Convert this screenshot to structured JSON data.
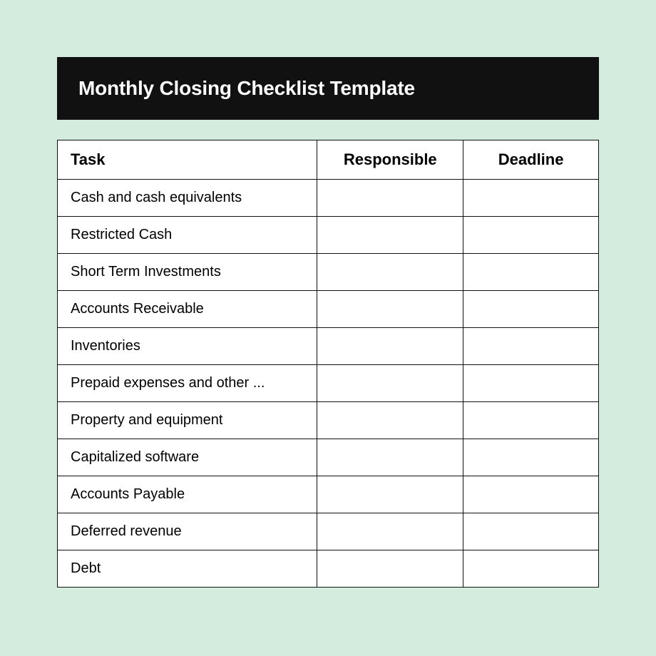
{
  "title": "Monthly Closing Checklist Template",
  "columns": {
    "task": "Task",
    "responsible": "Responsible",
    "deadline": "Deadline"
  },
  "rows": [
    {
      "task": "Cash and cash equivalents",
      "responsible": "",
      "deadline": ""
    },
    {
      "task": "Restricted Cash",
      "responsible": "",
      "deadline": ""
    },
    {
      "task": "Short Term Investments",
      "responsible": "",
      "deadline": ""
    },
    {
      "task": "Accounts Receivable",
      "responsible": "",
      "deadline": ""
    },
    {
      "task": "Inventories",
      "responsible": "",
      "deadline": ""
    },
    {
      "task": "Prepaid expenses and other ...",
      "responsible": "",
      "deadline": ""
    },
    {
      "task": "Property and equipment",
      "responsible": "",
      "deadline": ""
    },
    {
      "task": "Capitalized software",
      "responsible": "",
      "deadline": ""
    },
    {
      "task": "Accounts Payable",
      "responsible": "",
      "deadline": ""
    },
    {
      "task": "Deferred revenue",
      "responsible": "",
      "deadline": ""
    },
    {
      "task": "Debt",
      "responsible": "",
      "deadline": ""
    }
  ]
}
